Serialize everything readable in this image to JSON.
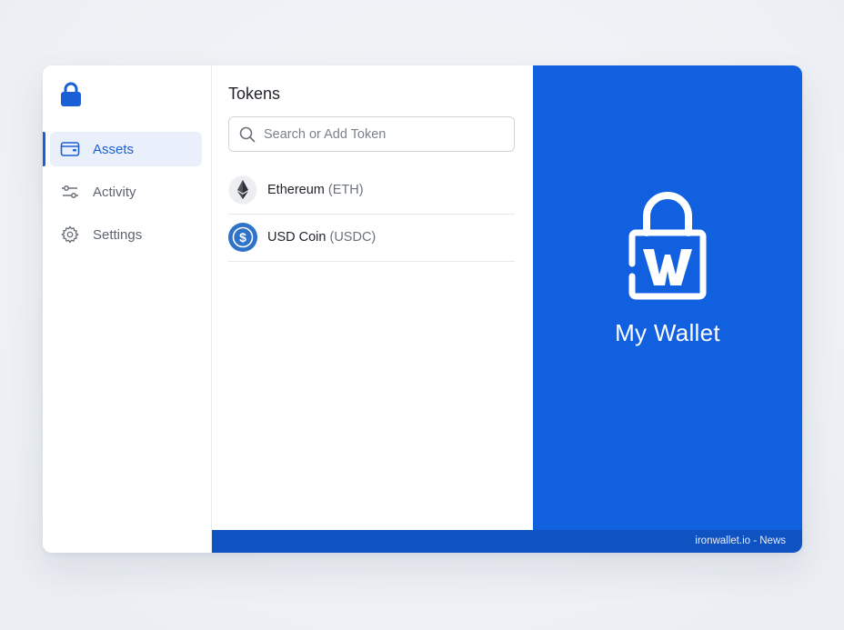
{
  "sidebar": {
    "logo_icon": "lock-icon",
    "items": [
      {
        "label": "Assets",
        "icon": "wallet-icon",
        "active": true
      },
      {
        "label": "Activity",
        "icon": "transfer-arrows-icon",
        "active": false
      },
      {
        "label": "Settings",
        "icon": "gear-icon",
        "active": false
      }
    ]
  },
  "tokens": {
    "title": "Tokens",
    "search": {
      "placeholder": "Search or Add Token",
      "value": ""
    },
    "list": [
      {
        "name": "Ethereum",
        "symbol": "(ETH)",
        "icon": "ethereum-icon"
      },
      {
        "name": "USD Coin",
        "symbol": "(USDC)",
        "icon": "usdc-icon"
      }
    ]
  },
  "hero": {
    "title": "My Wallet",
    "logo_icon": "wallet-lock-logo-icon"
  },
  "footer": {
    "text": "ironwallet.io - News"
  },
  "colors": {
    "accent": "#1a5fd6",
    "hero_bg": "#1160e0",
    "footer_bg": "#0f52c2",
    "active_bg": "#e9f0fb"
  }
}
